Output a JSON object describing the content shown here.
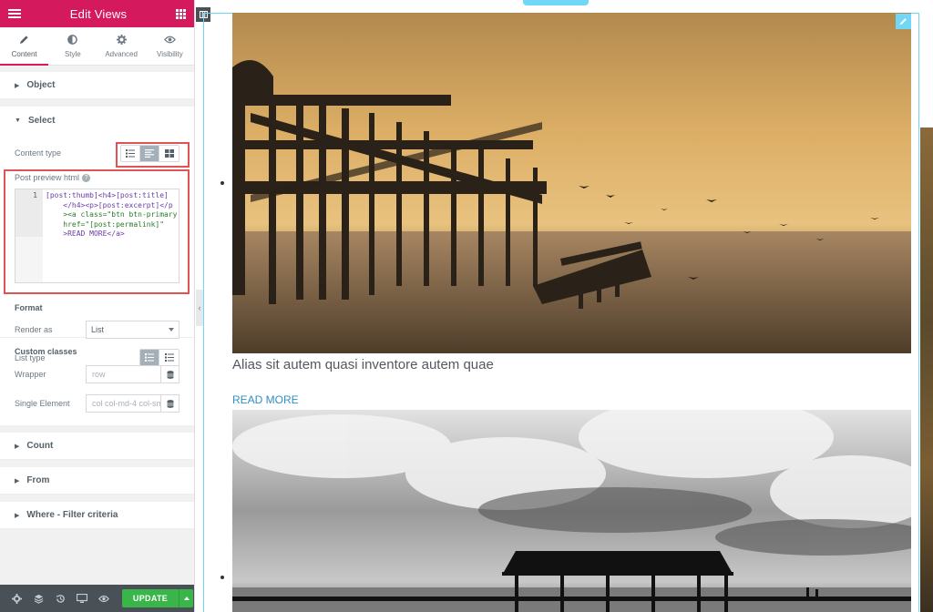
{
  "panel": {
    "title": "Edit Views",
    "tabs": [
      {
        "label": "Content",
        "icon": "pencil-icon",
        "active": true
      },
      {
        "label": "Style",
        "icon": "contrast-icon",
        "active": false
      },
      {
        "label": "Advanced",
        "icon": "gear-icon",
        "active": false
      },
      {
        "label": "Visibility",
        "icon": "eye-icon",
        "active": false
      }
    ],
    "sections": {
      "object": "Object",
      "select": "Select",
      "count": "Count",
      "from": "From",
      "where": "Where - Filter criteria"
    },
    "select": {
      "content_type_label": "Content type",
      "post_preview_label": "Post preview html",
      "help_glyph": "?",
      "code_line_number": "1",
      "code_lines": [
        "[post:thumb]<h4>[post:title]",
        "    </h4><p>[post:excerpt]</p",
        "    ><a class=\"btn btn-primary",
        "    href=\"[post:permalink]\"",
        "    >READ MORE</a>"
      ]
    },
    "format": {
      "heading": "Format",
      "render_as_label": "Render as",
      "render_as_value": "List",
      "list_type_label": "List type"
    },
    "custom_classes": {
      "heading": "Custom classes",
      "wrapper_label": "Wrapper",
      "wrapper_placeholder": "row",
      "single_label": "Single Element",
      "single_placeholder": "col col-md-4 col-sm"
    },
    "footer": {
      "update_label": "UPDATE"
    }
  },
  "preview": {
    "post1_title": "Alias sit autem quasi inventore autem quae",
    "read_more": "READ MORE"
  },
  "colors": {
    "brand": "#d5195d",
    "accent_outline": "#71d7f7",
    "update_green": "#39b54a",
    "link_blue": "#2f8fc4",
    "highlight_red": "#e05354"
  }
}
